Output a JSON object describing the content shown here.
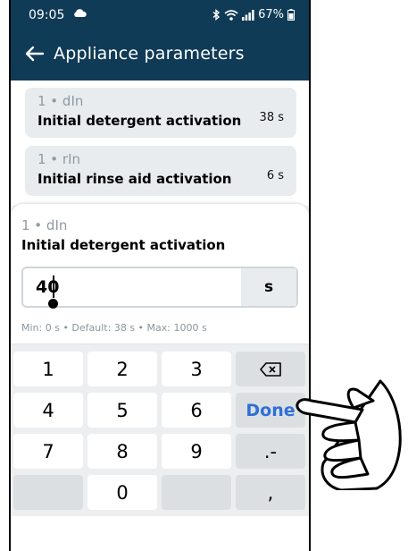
{
  "status_bar": {
    "time": "09:05",
    "battery": "67%"
  },
  "app_bar": {
    "title": "Appliance parameters"
  },
  "parameters": [
    {
      "code": "1 • dIn",
      "name": "Initial detergent activation",
      "value": "38 s"
    },
    {
      "code": "1 • rIn",
      "name": "Initial rinse aid activation",
      "value": "6 s"
    }
  ],
  "editor": {
    "code": "1 • dIn",
    "name": "Initial detergent activation",
    "input_value": "40",
    "unit": "s",
    "hint": "Min: 0 s • Default: 38 s • Max: 1000 s"
  },
  "keypad": {
    "keys": [
      [
        "1",
        "2",
        "3",
        "⌫"
      ],
      [
        "4",
        "5",
        "6",
        "Done"
      ],
      [
        "7",
        "8",
        "9",
        ".-"
      ],
      [
        "",
        "0",
        "",
        ","
      ]
    ]
  },
  "colors": {
    "header": "#0f3b57",
    "done": "#2f6fd8"
  },
  "icons": [
    "cloud-icon",
    "bluetooth-icon",
    "wifi-icon",
    "signal-icon",
    "battery-icon",
    "back-arrow-icon",
    "backspace-icon",
    "pointing-hand-icon"
  ]
}
